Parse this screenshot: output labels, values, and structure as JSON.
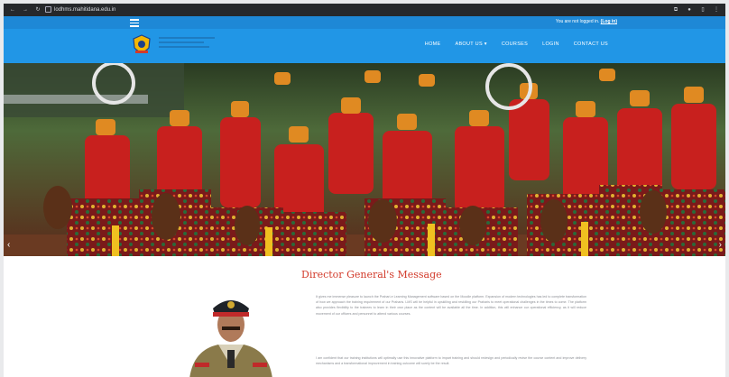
{
  "browser": {
    "url": "lodhms.mahitidana.edu.in",
    "nav_icons": [
      "back-arrow",
      "forward-arrow",
      "reload"
    ],
    "right_icons": [
      "extensions",
      "menu",
      "profile",
      "more"
    ]
  },
  "header": {
    "login_note_prefix": "You are not logged in.",
    "login_link": "(Log in)",
    "menu": [
      "HOME",
      "ABOUT US ▾",
      "COURSES",
      "LOGIN",
      "CONTACT US"
    ]
  },
  "hero": {
    "prev_label": "‹",
    "next_label": "›"
  },
  "message": {
    "title": "Director General's Message",
    "paragraph1": "It gives me immense pleasure to launch the Prahari-e Learning Management software based on the Moodle platform. Expansion of modern technologies has led to complete transformation of how we approach the training requirement of our Praharis. LMS will be helpful in upskilling and reskilling our Praharis to meet operational challenges in the times to come. The platform also provides flexibility to the trainees to learn in their own place as the content will be available all the time. In addition, this will enhance our operational efficiency, as it will reduce movement of our officers and personnel to attend various courses.",
    "paragraph2": "I am confident that our training institutions will optimally use this innovative platform to impart training and should redesign and periodically revise the course content and improve delivery mechanisms and a transformational improvement in training outcome will surely be the result."
  },
  "colors": {
    "navbar": "#2196e6",
    "utilbar": "#1e88d6",
    "title_red": "#d23a2a"
  }
}
